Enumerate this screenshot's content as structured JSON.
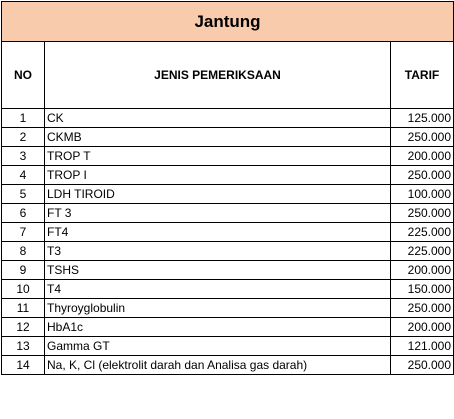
{
  "title": "Jantung",
  "headers": {
    "no": "NO",
    "jenis": "JENIS  PEMERIKSAAN",
    "tarif": "TARIF"
  },
  "accent_color": "#f8cbad",
  "rows": [
    {
      "no": "1",
      "jenis": "CK",
      "tarif": "125.000"
    },
    {
      "no": "2",
      "jenis": "CKMB",
      "tarif": "250.000"
    },
    {
      "no": "3",
      "jenis": "TROP T",
      "tarif": "200.000"
    },
    {
      "no": "4",
      "jenis": "TROP I",
      "tarif": "250.000"
    },
    {
      "no": "5",
      "jenis": "LDH TIROID",
      "tarif": "100.000"
    },
    {
      "no": "6",
      "jenis": "FT 3",
      "tarif": "250.000"
    },
    {
      "no": "7",
      "jenis": "FT4",
      "tarif": "225.000"
    },
    {
      "no": "8",
      "jenis": "T3",
      "tarif": "225.000"
    },
    {
      "no": "9",
      "jenis": "TSHS",
      "tarif": "200.000"
    },
    {
      "no": "10",
      "jenis": "T4",
      "tarif": "150.000"
    },
    {
      "no": "11",
      "jenis": "Thyroyglobulin",
      "tarif": "250.000"
    },
    {
      "no": "12",
      "jenis": "HbA1c",
      "tarif": "200.000"
    },
    {
      "no": "13",
      "jenis": "Gamma GT",
      "tarif": "121.000"
    },
    {
      "no": "14",
      "jenis": "Na, K, Cl (elektrolit darah dan Analisa gas darah)",
      "tarif": "250.000"
    }
  ]
}
